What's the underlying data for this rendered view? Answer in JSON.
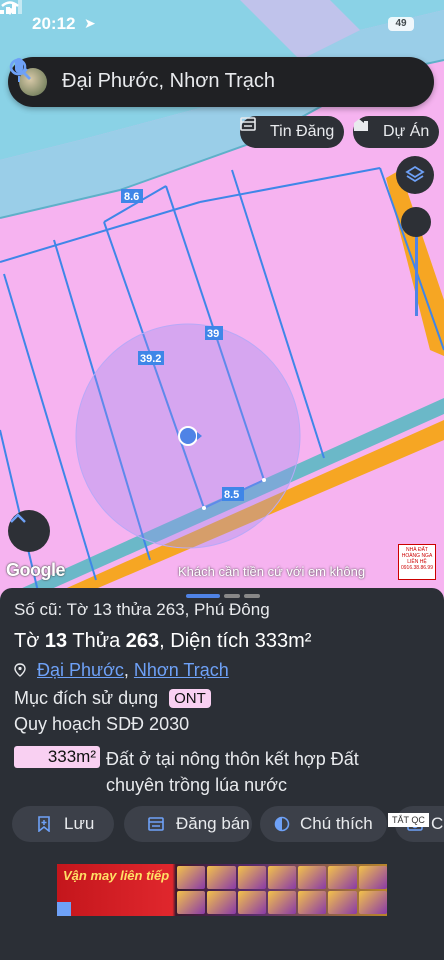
{
  "status_bar": {
    "time": "20:12",
    "battery": "49"
  },
  "search": {
    "query": "Đại Phước, Nhơn Trạch"
  },
  "chips": {
    "listings": "Tin Đăng",
    "projects": "Dự Án"
  },
  "map": {
    "dimensions": [
      "8.6",
      "39",
      "39.2",
      "8.5"
    ],
    "google_label": "Google",
    "ad_overlay_text": "Khách cần tiền cứ với em không",
    "colors": {
      "land": "#f6b3f0",
      "water": "#8ad2e6",
      "road": "#f6a623",
      "parcel_line": "#3f86e8"
    }
  },
  "sheet": {
    "old_parcel": "Số cũ: Tờ 13 thửa 263, Phú Đông",
    "title_prefix": "Tờ",
    "sheet_no": "13",
    "parcel_word": "Thửa",
    "parcel_no": "263",
    "area_label": ", Diện tích",
    "area": "333m²",
    "ward": "Đại Phước",
    "district": "Nhơn Trạch",
    "purpose_label": "Mục đích sử dụng",
    "purpose_code": "ONT",
    "plan_label": "Quy hoạch SDĐ 2030",
    "plan_area": "333m²",
    "plan_desc": "Đất ở tại nông thôn kết hợp Đất chuyên trồng lúa nước"
  },
  "actions": [
    {
      "label": "Lưu",
      "icon": "bookmark-plus-icon"
    },
    {
      "label": "Đăng bán",
      "icon": "listing-icon"
    },
    {
      "label": "Chú thích",
      "icon": "contrast-icon"
    },
    {
      "label": "C",
      "icon": "camera-icon"
    }
  ],
  "ad": {
    "close_label": "TẮT QC",
    "banner_text": "Vận may liên tiếp"
  }
}
